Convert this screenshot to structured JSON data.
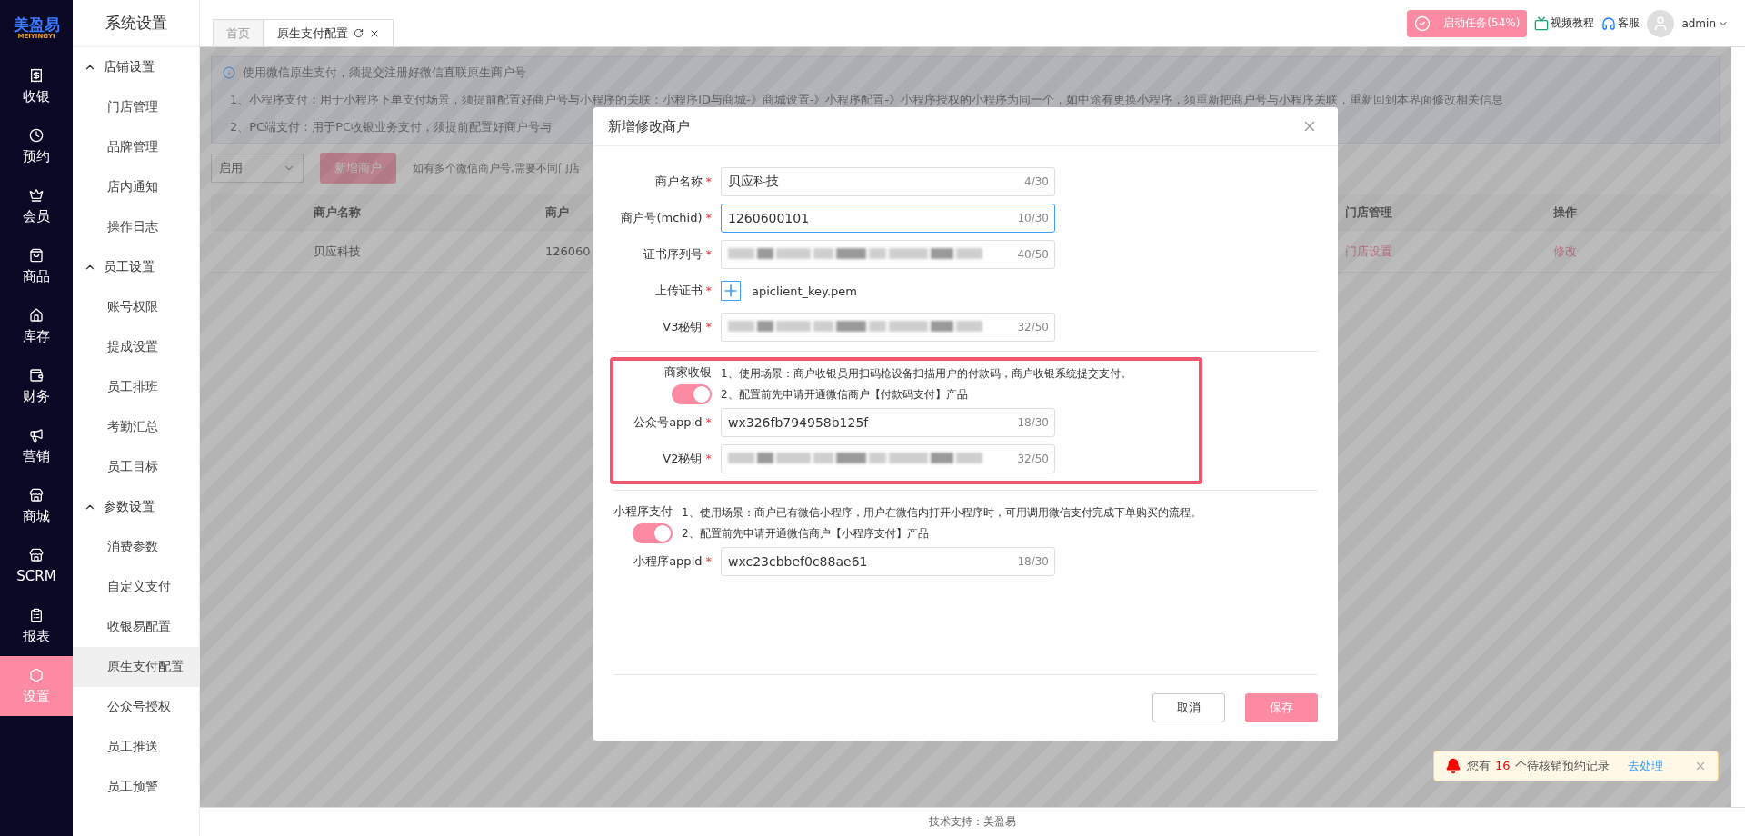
{
  "brand": {
    "name": "美盈易",
    "sub": "MEIYINGYI"
  },
  "nav": [
    {
      "label": "收银",
      "selected": false
    },
    {
      "label": "预约",
      "selected": false
    },
    {
      "label": "会员",
      "selected": false
    },
    {
      "label": "商品",
      "selected": false
    },
    {
      "label": "库存",
      "selected": false
    },
    {
      "label": "财务",
      "selected": false
    },
    {
      "label": "营销",
      "selected": false
    },
    {
      "label": "商城",
      "selected": false
    },
    {
      "label": "SCRM",
      "selected": false
    },
    {
      "label": "报表",
      "selected": false
    },
    {
      "label": "设置",
      "selected": true
    }
  ],
  "submenu": {
    "title": "系统设置",
    "groups": [
      {
        "label": "店铺设置",
        "expanded": true,
        "items": [
          {
            "label": "门店管理",
            "selected": false
          },
          {
            "label": "品牌管理",
            "selected": false
          },
          {
            "label": "店内通知",
            "selected": false
          },
          {
            "label": "操作日志",
            "selected": false
          }
        ]
      },
      {
        "label": "员工设置",
        "expanded": true,
        "items": [
          {
            "label": "账号权限",
            "selected": false
          },
          {
            "label": "提成设置",
            "selected": false
          },
          {
            "label": "员工排班",
            "selected": false
          },
          {
            "label": "考勤汇总",
            "selected": false
          },
          {
            "label": "员工目标",
            "selected": false
          }
        ]
      },
      {
        "label": "参数设置",
        "expanded": true,
        "items": [
          {
            "label": "消费参数",
            "selected": false
          },
          {
            "label": "自定义支付",
            "selected": false
          },
          {
            "label": "收银易配置",
            "selected": false
          },
          {
            "label": "原生支付配置",
            "selected": true
          },
          {
            "label": "公众号授权",
            "selected": false
          },
          {
            "label": "员工推送",
            "selected": false
          },
          {
            "label": "员工预警",
            "selected": false
          }
        ]
      }
    ]
  },
  "tabs": [
    {
      "label": "首页",
      "selected": false,
      "closable": false
    },
    {
      "label": "原生支付配置",
      "selected": true,
      "closable": true
    }
  ],
  "header": {
    "task": "启动任务(54%)",
    "video": "视频教程",
    "service": "客服",
    "user": "admin"
  },
  "notice": {
    "title": "使用微信原生支付，须提交注册好微信直联原生商户号",
    "lines": [
      "1、小程序支付：用于小程序下单支付场景，须提前配置好商户号与小程序的关联：小程序ID与商城-》商城设置-》小程序配置-》小程序授权的小程序为同一个，如中途有更换小程序，须重新把商户号与小程序关联，重新回到本界面修改相关信息",
      "2、PC端支付：用于PC收银业务支付，须提前配置好商户号与"
    ]
  },
  "filter": {
    "status": "启用",
    "add": "新增商户",
    "hint": "如有多个微信商户号,需要不同门店"
  },
  "table": {
    "columns": [
      "商户名称",
      "商户",
      "门店管理",
      "操作"
    ],
    "rows": [
      [
        "贝应科技",
        "126060",
        "门店设置",
        "修改"
      ]
    ]
  },
  "modal": {
    "title": "新增修改商户",
    "required_mark": "*",
    "fields": [
      {
        "kind": "text",
        "label": "商户名称",
        "required": true,
        "value": "贝应科技",
        "count": "4/30",
        "focused": false
      },
      {
        "kind": "text",
        "label": "商户号(mchid)",
        "required": true,
        "value": "1260600101",
        "count": "10/30",
        "focused": true
      },
      {
        "kind": "blurred",
        "label": "证书序列号",
        "required": true,
        "count": "40/50"
      },
      {
        "kind": "upload",
        "label": "上传证书",
        "required": true,
        "value": "apiclient_key.pem"
      },
      {
        "kind": "blurred",
        "label": "V3秘钥",
        "required": true,
        "count": "32/50"
      }
    ],
    "sections": [
      {
        "label": "商家收银",
        "on": true,
        "highlighted": true,
        "desc": [
          "1、使用场景：商户收银员用扫码枪设备扫描用户的付款码，商户收银系统提交支付。",
          "2、配置前先申请开通微信商户【付款码支付】产品"
        ],
        "fields": [
          {
            "kind": "text",
            "label": "公众号appid",
            "required": true,
            "value": "wx326fb794958b125f",
            "count": "18/30",
            "focused": false
          },
          {
            "kind": "blurred",
            "label": "V2秘钥",
            "required": true,
            "count": "32/50"
          }
        ]
      },
      {
        "label": "小程序支付",
        "on": true,
        "highlighted": false,
        "desc": [
          "1、使用场景：商户已有微信小程序，用户在微信内打开小程序时，可用调用微信支付完成下单购买的流程。",
          "2、配置前先申请开通微信商户【小程序支付】产品"
        ],
        "fields": [
          {
            "kind": "text",
            "label": "小程序appid",
            "required": true,
            "value": "wxc23cbbef0c88ae61",
            "count": "18/30",
            "focused": false
          }
        ]
      }
    ],
    "cancel": "取消",
    "save": "保存"
  },
  "toast": {
    "prefix": "您有",
    "count": "16",
    "suffix": "个待核销预约记录",
    "action": "去处理"
  },
  "footer": "技术支持：美盈易"
}
